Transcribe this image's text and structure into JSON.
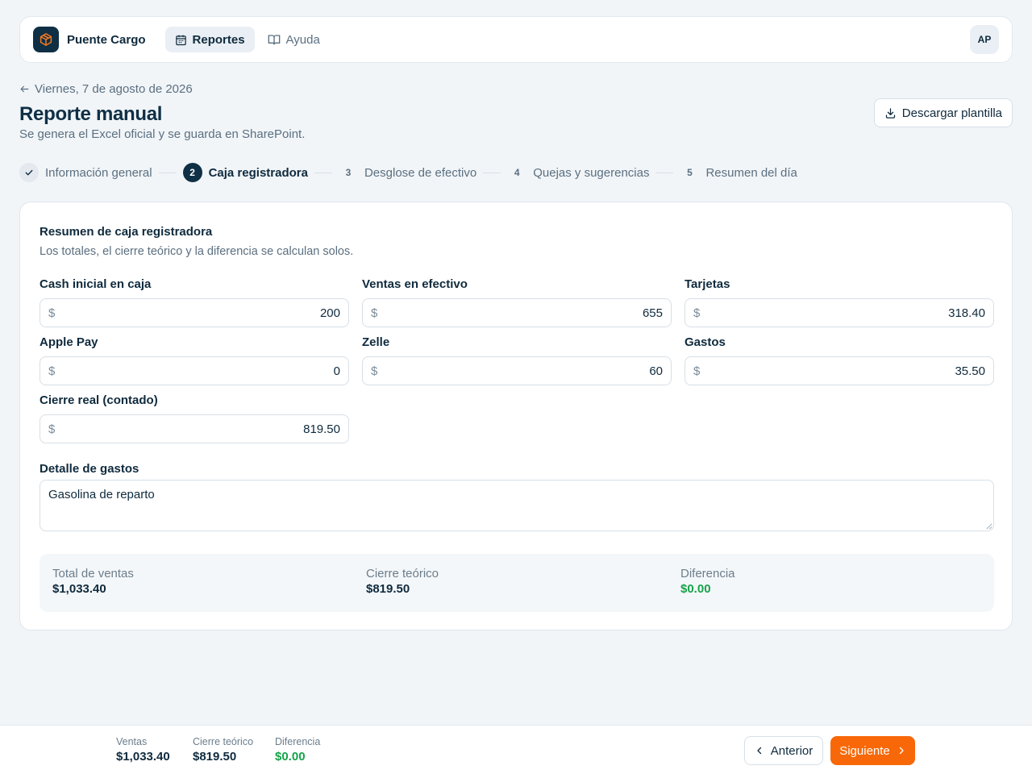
{
  "app": {
    "name": "Puente Cargo",
    "user_initials": "AP"
  },
  "nav": {
    "items": [
      {
        "label": "Reportes",
        "active": true
      },
      {
        "label": "Ayuda",
        "active": false
      }
    ]
  },
  "header": {
    "back_label": "Viernes, 7 de agosto de 2026",
    "title": "Reporte manual",
    "subtitle": "Se genera el Excel oficial y se guarda en SharePoint.",
    "download_label": "Descargar plantilla"
  },
  "steps": [
    {
      "number": "1",
      "label": "Información general",
      "state": "done"
    },
    {
      "number": "2",
      "label": "Caja registradora",
      "state": "active"
    },
    {
      "number": "3",
      "label": "Desglose de efectivo",
      "state": "pending"
    },
    {
      "number": "4",
      "label": "Quejas y sugerencias",
      "state": "pending"
    },
    {
      "number": "5",
      "label": "Resumen del día",
      "state": "pending"
    }
  ],
  "form": {
    "title": "Resumen de caja registradora",
    "description": "Los totales, el cierre teórico y la diferencia se calculan solos.",
    "currency_symbol": "$",
    "fields": [
      {
        "label": "Cash inicial en caja",
        "value": "200"
      },
      {
        "label": "Ventas en efectivo",
        "value": "655"
      },
      {
        "label": "Tarjetas",
        "value": "318.40"
      },
      {
        "label": "Apple Pay",
        "value": "0"
      },
      {
        "label": "Zelle",
        "value": "60"
      },
      {
        "label": "Gastos",
        "value": "35.50"
      },
      {
        "label": "Cierre real (contado)",
        "value": "819.50"
      }
    ],
    "expenses_label": "Detalle de gastos",
    "expenses_value": "Gasolina de reparto"
  },
  "totals": [
    {
      "label": "Total de ventas",
      "value": "$1,033.40"
    },
    {
      "label": "Cierre teórico",
      "value": "$819.50"
    },
    {
      "label": "Diferencia",
      "value": "$0.00"
    }
  ],
  "footer": {
    "stats": [
      {
        "label": "Ventas",
        "value": "$1,033.40"
      },
      {
        "label": "Cierre teórico",
        "value": "$819.50"
      },
      {
        "label": "Diferencia",
        "value": "$0.00"
      }
    ],
    "prev_label": "Anterior",
    "next_label": "Siguiente"
  },
  "colors": {
    "primary": "#0f2f45",
    "accent": "#f86808",
    "success": "#16a34a",
    "logo_icon": "#f47a1f"
  },
  "icons": [
    "box-icon",
    "calendar-icon",
    "book-icon",
    "arrow-left-icon",
    "download-icon",
    "check-icon",
    "chevron-left-icon",
    "chevron-right-icon"
  ]
}
